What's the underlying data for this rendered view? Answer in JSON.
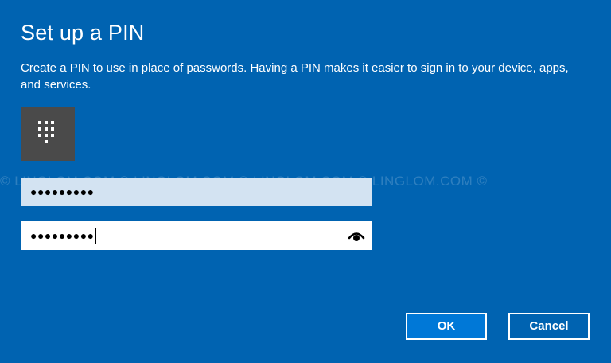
{
  "dialog": {
    "title": "Set up a PIN",
    "description": "Create a PIN to use in place of passwords. Having a PIN makes it easier to sign in to your device, apps, and services."
  },
  "icons": {
    "pin_tile": "keypad-icon",
    "reveal": "eye-icon"
  },
  "watermark": "© LINGLOM.COM    © LINGLOM.COM    © LINGLOM.COM    © LINGLOM.COM    ©",
  "fields": {
    "new_pin": {
      "value": "●●●●●●●●●"
    },
    "confirm_pin": {
      "value": "●●●●●●●●●"
    }
  },
  "buttons": {
    "ok_label": "OK",
    "cancel_label": "Cancel"
  },
  "colors": {
    "background": "#0063B1",
    "ok_button": "#0078D7",
    "tile": "#4A4A4A",
    "focused_field_fill": "#D3E3F2"
  }
}
